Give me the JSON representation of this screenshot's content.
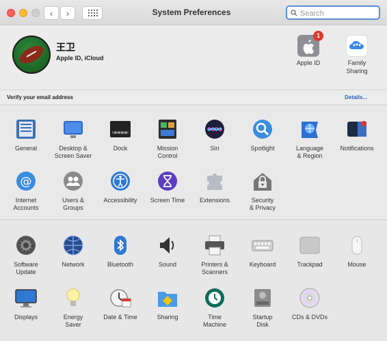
{
  "window": {
    "title": "System Preferences"
  },
  "search": {
    "placeholder": "Search",
    "value": ""
  },
  "profile": {
    "name": "王卫",
    "subtitle": "Apple ID, iCloud",
    "apple_id_label": "Apple ID",
    "apple_id_badge": "1",
    "family_label": "Family\nSharing"
  },
  "verify": {
    "message": "Verify your email address",
    "details_link": "Details..."
  },
  "section1": [
    {
      "id": "general",
      "label": "General",
      "icon": "general-icon"
    },
    {
      "id": "desktop-screen-saver",
      "label": "Desktop &\nScreen Saver",
      "icon": "desktop-icon"
    },
    {
      "id": "dock",
      "label": "Dock",
      "icon": "dock-icon"
    },
    {
      "id": "mission-control",
      "label": "Mission\nControl",
      "icon": "mission-control-icon"
    },
    {
      "id": "siri",
      "label": "Siri",
      "icon": "siri-icon"
    },
    {
      "id": "spotlight",
      "label": "Spotlight",
      "icon": "spotlight-icon"
    },
    {
      "id": "language-region",
      "label": "Language\n& Region",
      "icon": "globe-flag-icon"
    },
    {
      "id": "notifications",
      "label": "Notifications",
      "icon": "notifications-icon"
    },
    {
      "id": "internet-accounts",
      "label": "Internet\nAccounts",
      "icon": "at-icon"
    },
    {
      "id": "users-groups",
      "label": "Users &\nGroups",
      "icon": "users-icon"
    },
    {
      "id": "accessibility",
      "label": "Accessibility",
      "icon": "accessibility-icon"
    },
    {
      "id": "screen-time",
      "label": "Screen Time",
      "icon": "hourglass-icon"
    },
    {
      "id": "extensions",
      "label": "Extensions",
      "icon": "puzzle-icon"
    },
    {
      "id": "security-privacy",
      "label": "Security\n& Privacy",
      "icon": "house-lock-icon"
    }
  ],
  "section2": [
    {
      "id": "software-update",
      "label": "Software\nUpdate",
      "icon": "gear-icon"
    },
    {
      "id": "network",
      "label": "Network",
      "icon": "network-globe-icon"
    },
    {
      "id": "bluetooth",
      "label": "Bluetooth",
      "icon": "bluetooth-icon"
    },
    {
      "id": "sound",
      "label": "Sound",
      "icon": "speaker-icon"
    },
    {
      "id": "printers-scanners",
      "label": "Printers &\nScanners",
      "icon": "printer-icon"
    },
    {
      "id": "keyboard",
      "label": "Keyboard",
      "icon": "keyboard-icon"
    },
    {
      "id": "trackpad",
      "label": "Trackpad",
      "icon": "trackpad-icon"
    },
    {
      "id": "mouse",
      "label": "Mouse",
      "icon": "mouse-icon"
    },
    {
      "id": "displays",
      "label": "Displays",
      "icon": "display-icon"
    },
    {
      "id": "energy-saver",
      "label": "Energy\nSaver",
      "icon": "lightbulb-icon"
    },
    {
      "id": "date-time",
      "label": "Date & Time",
      "icon": "clock-calendar-icon"
    },
    {
      "id": "sharing",
      "label": "Sharing",
      "icon": "sharing-folder-icon"
    },
    {
      "id": "time-machine",
      "label": "Time\nMachine",
      "icon": "time-machine-icon"
    },
    {
      "id": "startup-disk",
      "label": "Startup\nDisk",
      "icon": "disk-icon"
    },
    {
      "id": "cds-dvds",
      "label": "CDs & DVDs",
      "icon": "cd-icon"
    }
  ],
  "colors": {
    "accent": "#2a63b5",
    "close": "#ff5f57",
    "minimize": "#febc2e",
    "badge": "#e0382e"
  }
}
